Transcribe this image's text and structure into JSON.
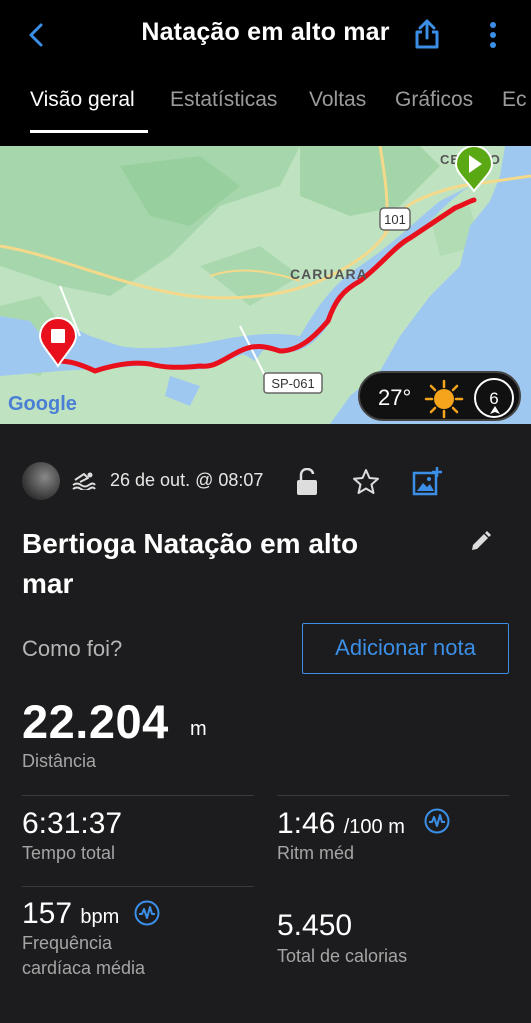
{
  "header": {
    "title": "Natação em alto mar"
  },
  "tabs": [
    {
      "label": "Visão geral",
      "active": true
    },
    {
      "label": "Estatísticas"
    },
    {
      "label": "Voltas"
    },
    {
      "label": "Gráficos"
    },
    {
      "label": "Ec"
    }
  ],
  "map": {
    "labels": {
      "caruara": "CARUARA",
      "road_101": "101",
      "road_sp061": "SP-061",
      "centro": "CENTRO",
      "google": "Google"
    },
    "weather": {
      "temperature": "27°",
      "wind": "6"
    },
    "route_color": "#e8101c",
    "start_marker_color": "#5aa914",
    "end_marker_color": "#e8101c"
  },
  "activity": {
    "date": "26 de out. @ 08:07",
    "title": "Bertioga Natação em alto mar",
    "how_label": "Como foi?",
    "add_note": "Adicionar nota",
    "distance": {
      "value": "22.204",
      "unit": "m",
      "label": "Distância"
    },
    "stats": {
      "total_time": {
        "value": "6:31:37",
        "label": "Tempo total"
      },
      "avg_pace": {
        "value": "1:46",
        "unit": "/100 m",
        "label": "Ritm méd"
      },
      "avg_hr": {
        "value": "157",
        "unit": "bpm",
        "label": "Frequência cardíaca média"
      },
      "calories": {
        "value": "5.450",
        "label": "Total de calorias"
      }
    }
  },
  "colors": {
    "accent": "#3b8fe6",
    "background": "#1c1c1e"
  }
}
